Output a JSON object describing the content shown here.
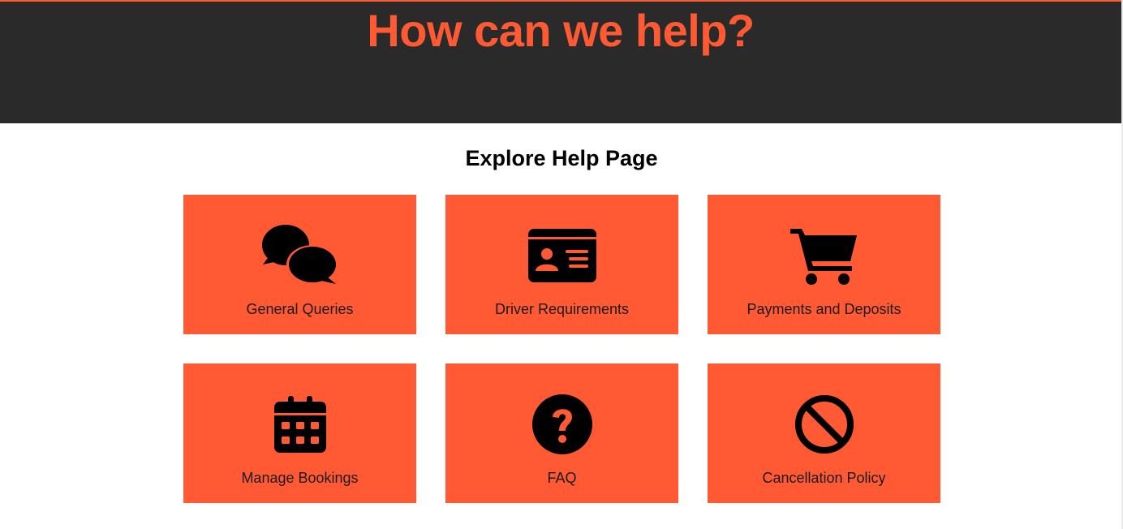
{
  "hero": {
    "title": "How can we help?"
  },
  "main": {
    "section_title": "Explore Help Page",
    "cards": [
      {
        "label": "General Queries",
        "icon": "chat-bubbles-icon"
      },
      {
        "label": "Driver Requirements",
        "icon": "id-card-icon"
      },
      {
        "label": "Payments and Deposits",
        "icon": "shopping-cart-icon"
      },
      {
        "label": "Manage Bookings",
        "icon": "calendar-icon"
      },
      {
        "label": "FAQ",
        "icon": "question-circle-icon"
      },
      {
        "label": "Cancellation Policy",
        "icon": "ban-icon"
      }
    ]
  },
  "colors": {
    "accent": "#ff5a33",
    "header_background": "#2a2a2a",
    "page_background": "#ffffff",
    "icon": "#000000",
    "text": "#000000"
  }
}
